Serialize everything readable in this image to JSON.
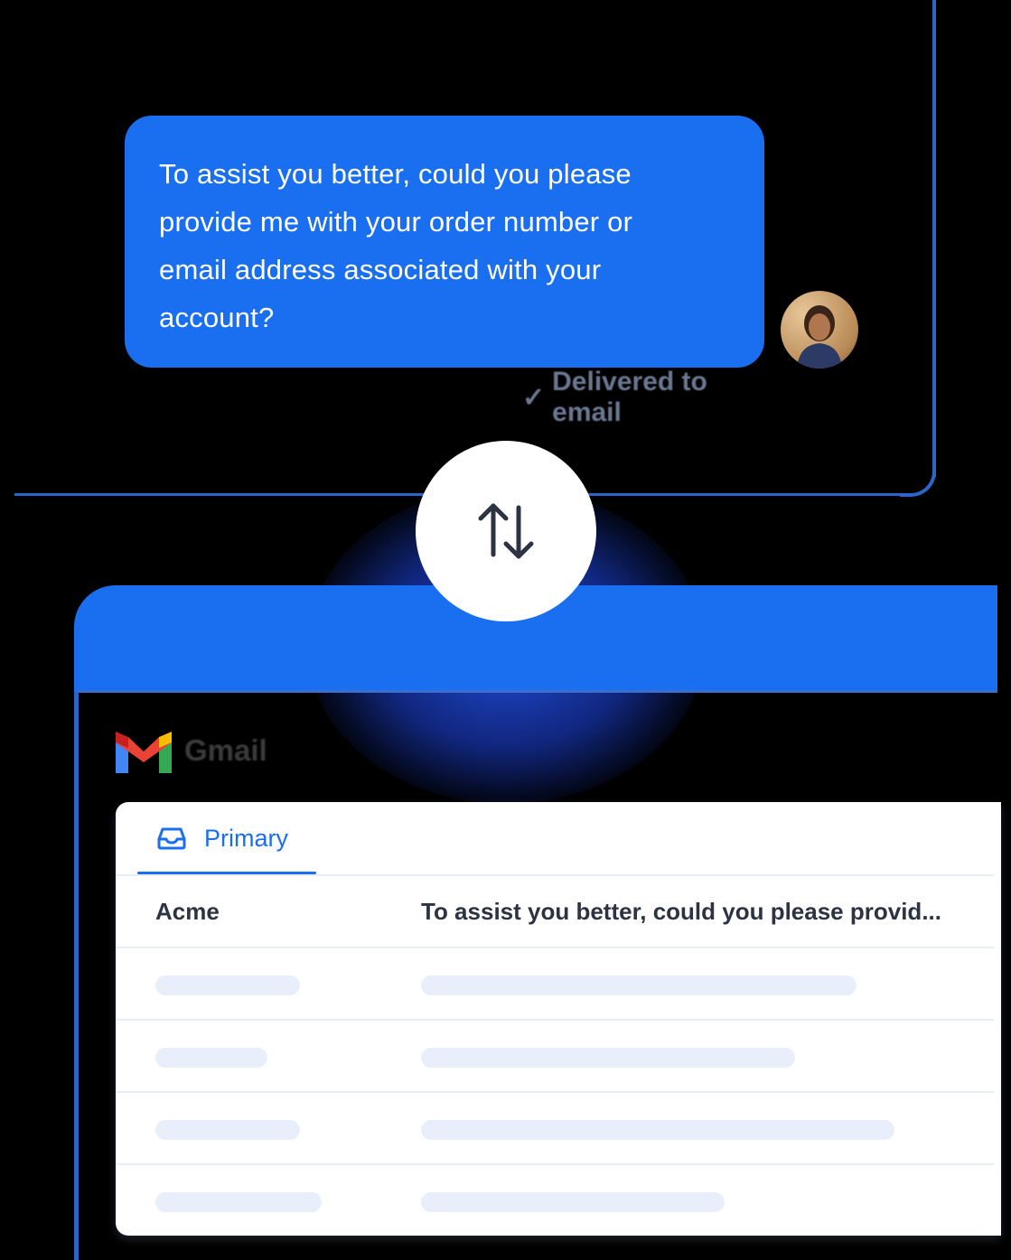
{
  "chat": {
    "message": "To assist you better, could you please provide me with your order number or email address associated with your account?",
    "lines": [
      "To assist you better, could you please",
      "provide me with your order number or",
      "email address associated with your",
      "account?"
    ],
    "status": "Delivered to email"
  },
  "colors": {
    "accent": "#1a6ef0",
    "frame": "#2b65c8",
    "text_dark": "#2c3342",
    "placeholder": "#e8effa"
  },
  "email": {
    "app_name": "Gmail",
    "tab_label": "Primary",
    "rows": [
      {
        "sender": "Acme",
        "snippet": "To assist you better, could you please provid..."
      }
    ]
  },
  "icons": {
    "swap": "arrows-up-down-icon",
    "inbox": "inbox-tray-icon",
    "check": "check-icon",
    "logo": "gmail-logo-icon"
  }
}
